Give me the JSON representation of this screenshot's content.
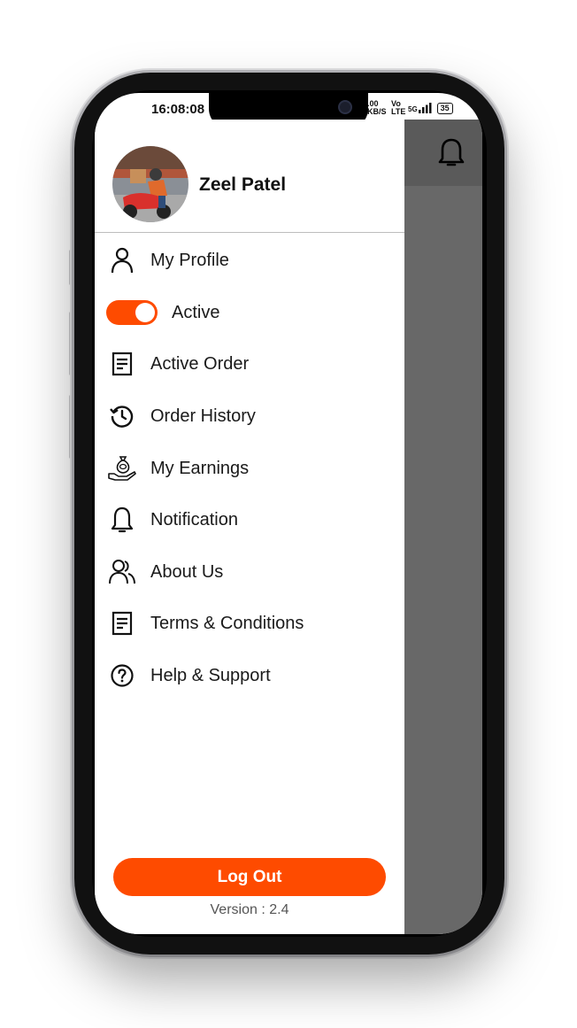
{
  "status_bar": {
    "time": "16:08:08",
    "net_speed": ".00 KB/S",
    "volte": "Vo LTE",
    "signal": "5G",
    "battery": "35"
  },
  "profile": {
    "name": "Zeel Patel"
  },
  "menu": {
    "items": [
      {
        "label": "My Profile",
        "icon": "user-icon"
      },
      {
        "label": "Active",
        "icon": "toggle-switch",
        "toggle_on": true
      },
      {
        "label": "Active Order",
        "icon": "document-icon"
      },
      {
        "label": "Order History",
        "icon": "history-icon"
      },
      {
        "label": "My Earnings",
        "icon": "money-bag-hand-icon"
      },
      {
        "label": "Notification",
        "icon": "bell-icon"
      },
      {
        "label": "About Us",
        "icon": "users-icon"
      },
      {
        "label": "Terms & Conditions",
        "icon": "document-icon"
      },
      {
        "label": "Help & Support",
        "icon": "help-circle-icon"
      }
    ]
  },
  "footer": {
    "logout_label": "Log Out",
    "version": "Version : 2.4"
  },
  "colors": {
    "accent": "#fe4b00",
    "overlay": "#686868"
  }
}
